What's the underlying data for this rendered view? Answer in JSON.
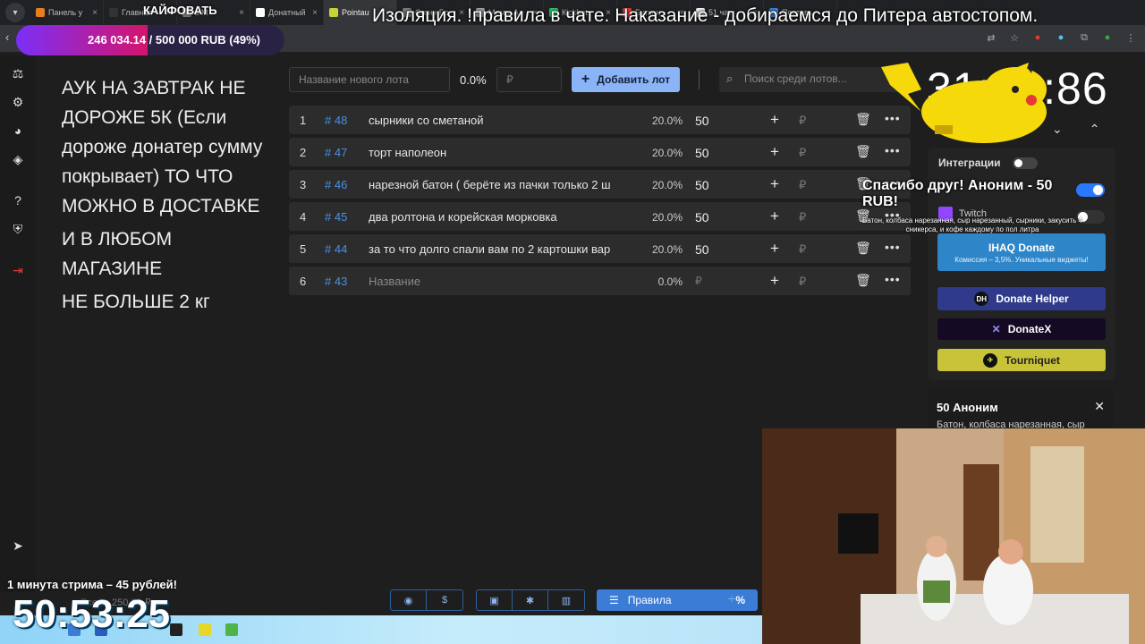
{
  "browser": {
    "tabs": [
      {
        "label": "Панель у",
        "color": "#e87d1e"
      },
      {
        "label": "Главная",
        "color": "#333333"
      },
      {
        "label": "s М",
        "color": "#777777"
      },
      {
        "label": "Донатный",
        "color": "#ffffff"
      },
      {
        "label": "Pointau",
        "color": "#c7d23b"
      },
      {
        "label": "Сгенч Бо",
        "color": "#7a7a7a"
      },
      {
        "label": "Мемы Ал",
        "color": "#9aa0a6"
      },
      {
        "label": "Кickbot",
        "color": "#2ec26b"
      },
      {
        "label": "Буткон",
        "color": "#e53935"
      },
      {
        "label": "51 чат",
        "color": "#f0f0f0"
      },
      {
        "label": "Поставь",
        "color": "#3b7cd6"
      }
    ]
  },
  "overlay": {
    "stream_title": "КАЙФОВАТЬ",
    "goal_progress": "246 034.14 / 500 000 RUB (49%)",
    "goal_fraction": 0.49,
    "marquee": "Изоляция. !правила в чате. Наказание - добираемся до Питера автостопом."
  },
  "rules_text": [
    "АУК НА ЗАВТРАК НЕ ДОРОЖЕ 5К (Если дороже донатер сумму покрывает) ТО ЧТО МОЖНО В ДОСТАВКЕ",
    "И В ЛЮБОМ МАГАЗИНЕ",
    "НЕ БОЛЬШЕ 2 кг"
  ],
  "toolbar": {
    "new_lot_placeholder": "Название нового лота",
    "percent": "0.0%",
    "rub_placeholder": "₽",
    "add_lot_label": "Добавить лот",
    "search_placeholder": "Поиск среди лотов..."
  },
  "lots": [
    {
      "num": "1",
      "id": "# 48",
      "name": "сырники со сметаной",
      "pct": "20.0%",
      "amount": "50"
    },
    {
      "num": "2",
      "id": "# 47",
      "name": "торт наполеон",
      "pct": "20.0%",
      "amount": "50"
    },
    {
      "num": "3",
      "id": "# 46",
      "name": "нарезной батон ( берёте из пачки только 2 ш",
      "pct": "20.0%",
      "amount": "50"
    },
    {
      "num": "4",
      "id": "# 45",
      "name": "два ролтона и корейская морковка",
      "pct": "20.0%",
      "amount": "50"
    },
    {
      "num": "5",
      "id": "# 44",
      "name": "за то что долго спали вам по 2 картошки вар",
      "pct": "20.0%",
      "amount": "50"
    },
    {
      "num": "6",
      "id": "# 43",
      "name": "Название",
      "pct": "0.0%",
      "amount": "₽"
    }
  ],
  "right_panel": {
    "timer": "31:36:86",
    "integrations_title": "Интеграции",
    "twitch_label": "Twitch",
    "ihaq_label": "IHAQ Donate",
    "ihaq_sub": "Комиссия – 3,5%. Уникальные виджеты!",
    "helper_label": "Donate Helper",
    "donatex_label": "DonateX",
    "tourniquet_label": "Tourniquet"
  },
  "alert": {
    "thanks": "Спасибо друг! Аноним - 50 RUB!",
    "message": "Батон, колбаса нарезанная, сыр нарезанный, сырники, закусить 4 сникерса, и кофе каждому по пол литра"
  },
  "donation_card": {
    "title": "50 Аноним",
    "message": "Батон, колбаса нарезанная, сыр"
  },
  "bottom": {
    "rules_button": "Правила",
    "percent_icon": "%",
    "stream_price": "1 минута стрима – 45 рублей!",
    "total": "Всего: 250.00 ₽",
    "clock": "50:53:25"
  }
}
